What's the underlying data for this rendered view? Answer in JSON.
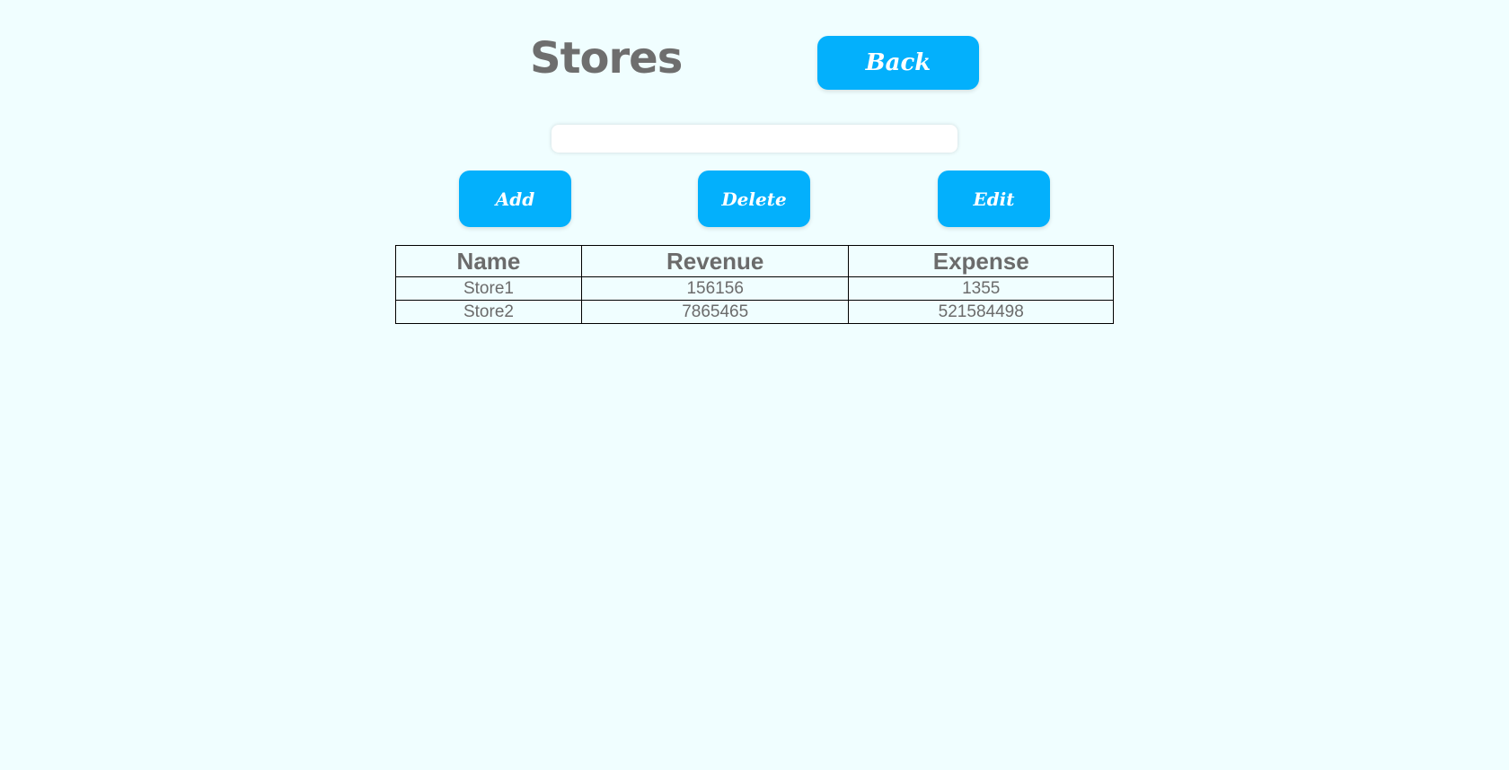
{
  "header": {
    "title": "Stores",
    "back_label": "Back"
  },
  "search": {
    "value": "",
    "placeholder": ""
  },
  "actions": {
    "add_label": "Add",
    "delete_label": "Delete",
    "edit_label": "Edit"
  },
  "table": {
    "columns": [
      "Name",
      "Revenue",
      "Expense"
    ],
    "rows": [
      [
        "Store1",
        "156156",
        "1355"
      ],
      [
        "Store2",
        "7865465",
        "521584498"
      ]
    ]
  },
  "colors": {
    "background": "#f0feff",
    "accent": "#03b0fc",
    "text": "#6b6b6b",
    "button_text": "#ffffff"
  }
}
